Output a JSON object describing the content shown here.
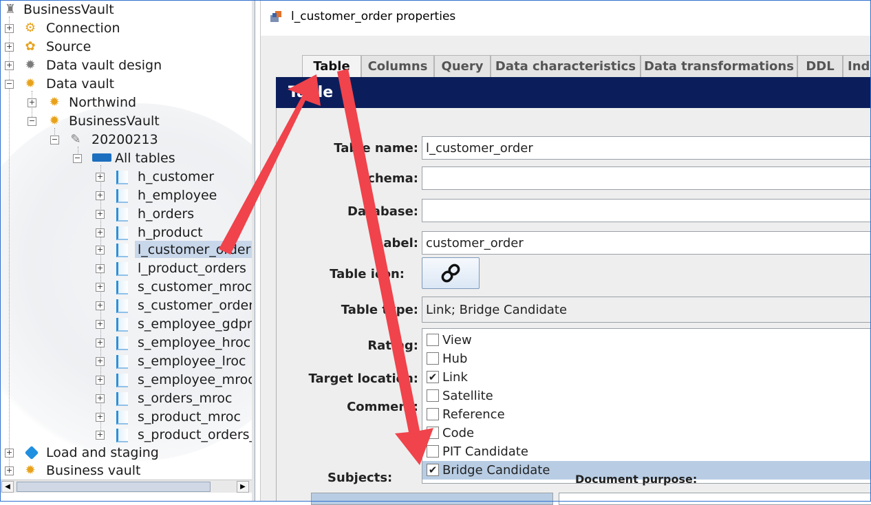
{
  "tree": {
    "root": "BusinessVault",
    "items": [
      {
        "label": "Connection",
        "icon": "connection-icon"
      },
      {
        "label": "Source",
        "icon": "source-icon"
      },
      {
        "label": "Data vault design",
        "icon": "gear-icon"
      },
      {
        "label": "Data vault",
        "icon": "gear-icon"
      },
      {
        "label": "Northwind",
        "icon": "gear-icon"
      },
      {
        "label": "BusinessVault",
        "icon": "gear-icon"
      },
      {
        "label": "20200213",
        "icon": "version-icon"
      },
      {
        "label": "All tables",
        "icon": "tables-icon"
      },
      {
        "label": "h_customer",
        "icon": "table-icon"
      },
      {
        "label": "h_employee",
        "icon": "table-icon"
      },
      {
        "label": "h_orders",
        "icon": "table-icon"
      },
      {
        "label": "h_product",
        "icon": "table-icon"
      },
      {
        "label": "l_customer_order",
        "icon": "table-icon"
      },
      {
        "label": "l_product_orders",
        "icon": "table-icon"
      },
      {
        "label": "s_customer_mroc",
        "icon": "table-icon"
      },
      {
        "label": "s_customer_order",
        "icon": "table-icon"
      },
      {
        "label": "s_employee_gdpr",
        "icon": "table-icon"
      },
      {
        "label": "s_employee_hroc",
        "icon": "table-icon"
      },
      {
        "label": "s_employee_lroc",
        "icon": "table-icon"
      },
      {
        "label": "s_employee_mroc",
        "icon": "table-icon"
      },
      {
        "label": "s_orders_mroc",
        "icon": "table-icon"
      },
      {
        "label": "s_product_mroc",
        "icon": "table-icon"
      },
      {
        "label": "s_product_orders_",
        "icon": "table-icon"
      },
      {
        "label": "Load and staging",
        "icon": "cube-icon"
      },
      {
        "label": "Business vault",
        "icon": "gear-icon"
      }
    ]
  },
  "props": {
    "title": "l_customer_order properties",
    "tabs": [
      "Table",
      "Columns",
      "Query",
      "Data characteristics",
      "Data transformations",
      "DDL",
      "Ind"
    ],
    "section": "Table",
    "labels": {
      "table_name": "Table name:",
      "schema": "Schema:",
      "database": "Database:",
      "label": "Label:",
      "table_icon": "Table icon:",
      "table_type": "Table type:",
      "rating": "Rating:",
      "target_location": "Target location:",
      "comment": "Comment:"
    },
    "values": {
      "table_name": "l_customer_order",
      "schema": "",
      "database": "",
      "label": "customer_order",
      "table_type": "Link; Bridge Candidate"
    },
    "type_options": [
      {
        "label": "View",
        "checked": false
      },
      {
        "label": "Hub",
        "checked": false
      },
      {
        "label": "Link",
        "checked": true
      },
      {
        "label": "Satellite",
        "checked": false
      },
      {
        "label": "Reference",
        "checked": false
      },
      {
        "label": "Code",
        "checked": false
      },
      {
        "label": "PIT Candidate",
        "checked": false
      },
      {
        "label": "Bridge Candidate",
        "checked": true
      }
    ],
    "subjects_label": "Subjects:",
    "doc_purpose_label": "Document purpose:"
  },
  "colors": {
    "section_header": "#0b1e5b",
    "arrow": "#f0434b",
    "selection": "#b8cde4"
  }
}
